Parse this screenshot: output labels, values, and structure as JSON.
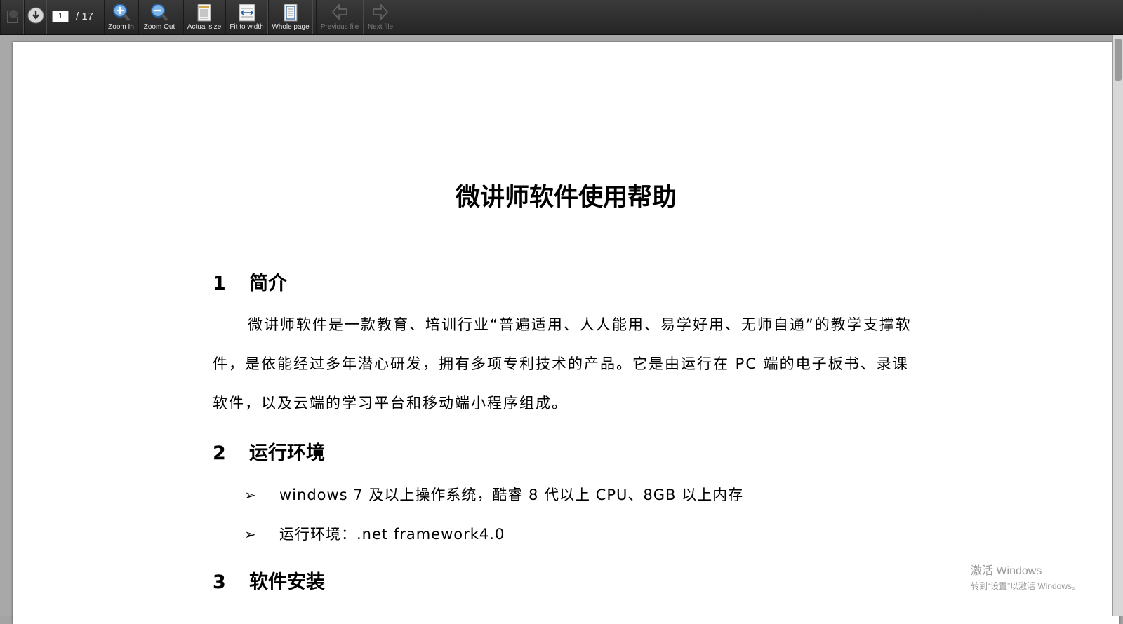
{
  "toolbar": {
    "buttons": [
      {
        "label": "Zoom In",
        "icon": "zoom-in-icon"
      },
      {
        "label": "Zoom Out",
        "icon": "zoom-out-icon"
      },
      {
        "label": "Actual size",
        "icon": "actual-size-icon"
      },
      {
        "label": "Fit to width",
        "icon": "fit-width-icon"
      },
      {
        "label": "Whole page",
        "icon": "whole-page-icon"
      },
      {
        "label": "Previous file",
        "icon": "arrow-left-icon",
        "disabled": true
      },
      {
        "label": "Next file",
        "icon": "arrow-right-icon",
        "disabled": true
      }
    ],
    "page_current": "1",
    "page_total": "/ 17"
  },
  "document": {
    "title": "微讲师软件使用帮助",
    "sections": [
      {
        "num": "1",
        "heading": "简介",
        "paragraph": "微讲师软件是一款教育、培训行业“普遍适用、人人能用、易学好用、无师自通”的教学支撑软件，是依能经过多年潜心研发，拥有多项专利技术的产品。它是由运行在 PC 端的电子板书、录课软件，以及云端的学习平台和移动端小程序组成。"
      },
      {
        "num": "2",
        "heading": "运行环境",
        "bullet_marker": "➢",
        "bullets": [
          "windows 7 及以上操作系统，酷睿 8 代以上 CPU、8GB 以上内存",
          "运行环境：.net framework4.0"
        ]
      },
      {
        "num": "3",
        "heading": "软件安装"
      }
    ]
  },
  "watermark": {
    "line1": "激活 Windows",
    "line2": "转到“设置”以激活 Windows。"
  },
  "colors": {
    "toolbar_bg": "#2e2e2e",
    "viewer_bg": "#a8a8a8",
    "page_bg": "#ffffff",
    "disabled_text": "#7a7a7a"
  }
}
